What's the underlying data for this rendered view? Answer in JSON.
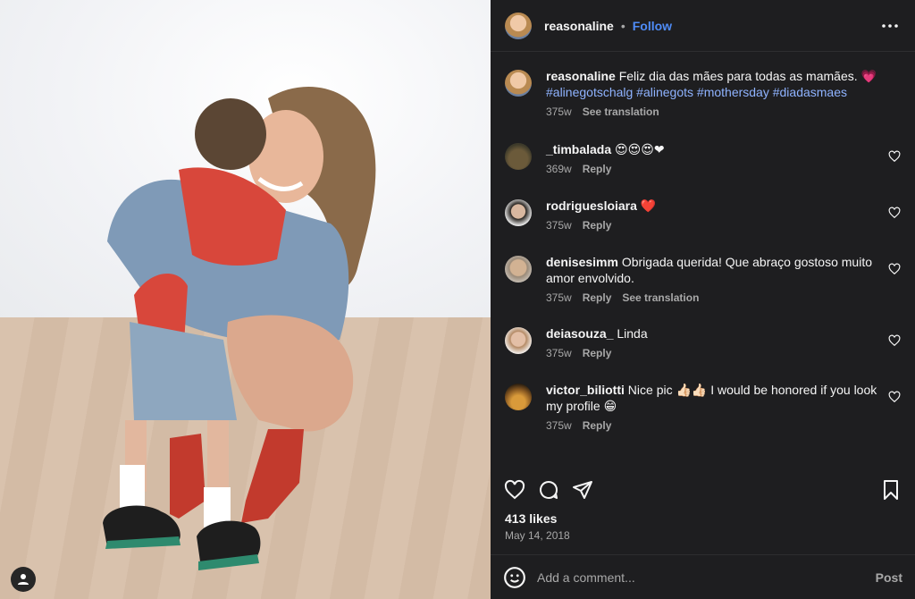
{
  "post": {
    "author": "reasonaline",
    "follow_label": "Follow",
    "separator": "•",
    "caption": {
      "user": "reasonaline",
      "text": "Feliz dia das mães para todas as mamães. 💗",
      "hashtags": "#alinegotschalg #alinegots #mothersday #diadasmaes",
      "age": "375w",
      "translate": "See translation"
    },
    "comments": [
      {
        "user": "_timbalada",
        "text": "😍😍😍❤",
        "age": "369w",
        "reply": "Reply",
        "translate": ""
      },
      {
        "user": "rodriguesloiara",
        "text": "❤️",
        "age": "375w",
        "reply": "Reply",
        "translate": ""
      },
      {
        "user": "denisesimm",
        "text": "Obrigada querida! Que abraço gostoso muito amor envolvido.",
        "age": "375w",
        "reply": "Reply",
        "translate": "See translation"
      },
      {
        "user": "deiasouza_",
        "text": "Linda",
        "age": "375w",
        "reply": "Reply",
        "translate": ""
      },
      {
        "user": "victor_biliotti",
        "text": "Nice pic 👍🏻👍🏻 I would be honored if you look my profile 😁",
        "age": "375w",
        "reply": "Reply",
        "translate": ""
      }
    ],
    "likes": "413 likes",
    "date": "May 14, 2018",
    "add_comment_placeholder": "Add a comment...",
    "post_label": "Post"
  },
  "icons": {
    "more": "more-options-icon",
    "like": "heart-icon",
    "comment": "comment-icon",
    "share": "paper-plane-icon",
    "save": "bookmark-icon",
    "emoji": "emoji-icon",
    "user": "user-icon"
  },
  "colors": {
    "panel_bg": "#1e1e20",
    "link_blue": "#4f8cf7",
    "hashtag": "#8fb3ff",
    "muted": "#a8a8a8"
  }
}
